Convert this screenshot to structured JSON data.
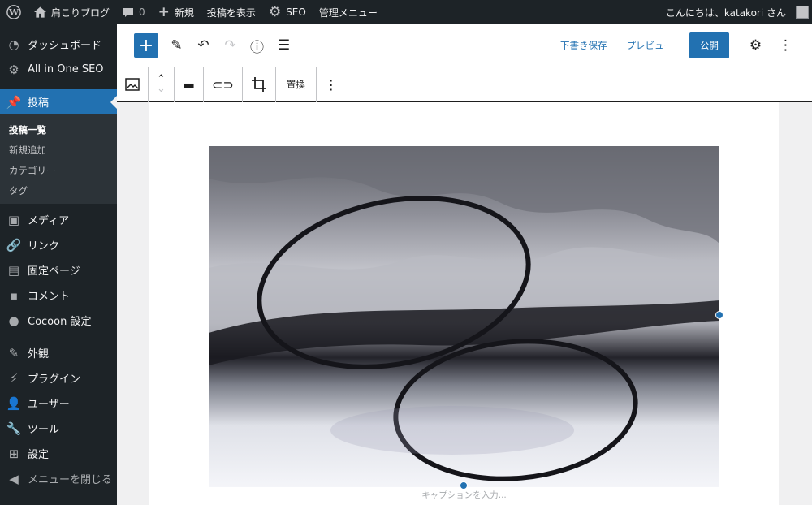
{
  "adminbar": {
    "site_name": "肩こりブログ",
    "comments_count": "0",
    "new_label": "新規",
    "view_post_label": "投稿を表示",
    "seo_label": "SEO",
    "admin_menu_label": "管理メニュー",
    "greeting": "こんにちは、katakori さん"
  },
  "sidebar": {
    "dashboard": "ダッシュボード",
    "aioseo": "All in One SEO",
    "posts": "投稿",
    "submenu": [
      "投稿一覧",
      "新規追加",
      "カテゴリー",
      "タグ"
    ],
    "media": "メディア",
    "links": "リンク",
    "pages": "固定ページ",
    "comments": "コメント",
    "cocoon": "Cocoon 設定",
    "appearance": "外観",
    "plugins": "プラグイン",
    "users": "ユーザー",
    "tools": "ツール",
    "settings": "設定",
    "collapse": "メニューを閉じる"
  },
  "topbar": {
    "save_draft": "下書き保存",
    "preview": "プレビュー",
    "publish": "公開"
  },
  "blocktoolbar": {
    "replace": "置換"
  },
  "canvas": {
    "caption_placeholder": "キャプションを入力..."
  },
  "colors": {
    "accent": "#2271b1",
    "admin_bg": "#1d2327"
  }
}
